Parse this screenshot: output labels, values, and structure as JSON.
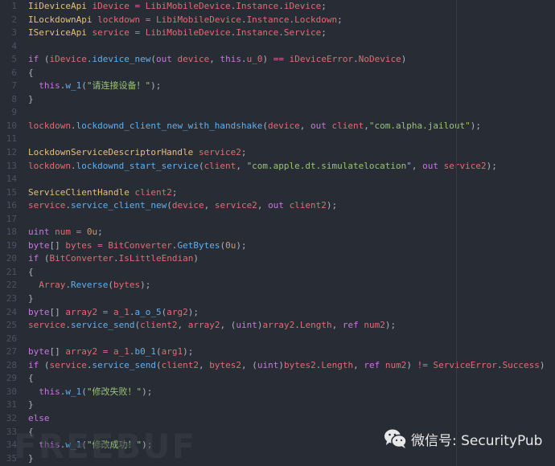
{
  "code": {
    "lines": [
      [
        [
          "t",
          "IiDeviceApi"
        ],
        [
          "p",
          " "
        ],
        [
          "v",
          "iDevice"
        ],
        [
          "o",
          " = "
        ],
        [
          "v",
          "LibiMobileDevice"
        ],
        [
          "p",
          "."
        ],
        [
          "v",
          "Instance"
        ],
        [
          "p",
          "."
        ],
        [
          "v",
          "iDevice"
        ],
        [
          "p",
          ";"
        ]
      ],
      [
        [
          "t",
          "ILockdownApi"
        ],
        [
          "p",
          " "
        ],
        [
          "v",
          "lockdown"
        ],
        [
          "o",
          " = "
        ],
        [
          "v",
          "LibiMobileDevice"
        ],
        [
          "p",
          "."
        ],
        [
          "v",
          "Instance"
        ],
        [
          "p",
          "."
        ],
        [
          "v",
          "Lockdown"
        ],
        [
          "p",
          ";"
        ]
      ],
      [
        [
          "t",
          "IServiceApi"
        ],
        [
          "p",
          " "
        ],
        [
          "v",
          "service"
        ],
        [
          "o",
          " = "
        ],
        [
          "v",
          "LibiMobileDevice"
        ],
        [
          "p",
          "."
        ],
        [
          "v",
          "Instance"
        ],
        [
          "p",
          "."
        ],
        [
          "v",
          "Service"
        ],
        [
          "p",
          ";"
        ]
      ],
      [],
      [
        [
          "k",
          "if"
        ],
        [
          "p",
          " ("
        ],
        [
          "v",
          "iDevice"
        ],
        [
          "p",
          "."
        ],
        [
          "f",
          "idevice_new"
        ],
        [
          "p",
          "("
        ],
        [
          "k",
          "out"
        ],
        [
          "p",
          " "
        ],
        [
          "v",
          "device"
        ],
        [
          "p",
          ", "
        ],
        [
          "k",
          "this"
        ],
        [
          "p",
          "."
        ],
        [
          "v",
          "u_0"
        ],
        [
          "p",
          ") "
        ],
        [
          "o",
          "=="
        ],
        [
          "p",
          " "
        ],
        [
          "v",
          "iDeviceError"
        ],
        [
          "p",
          "."
        ],
        [
          "v",
          "NoDevice"
        ],
        [
          "p",
          ")"
        ]
      ],
      [
        [
          "p",
          "{"
        ]
      ],
      [
        [
          "p",
          "  "
        ],
        [
          "k",
          "this"
        ],
        [
          "p",
          "."
        ],
        [
          "f",
          "w_1"
        ],
        [
          "p",
          "("
        ],
        [
          "s",
          "\"请连接设备！\""
        ],
        [
          "p",
          ");"
        ]
      ],
      [
        [
          "p",
          "}"
        ]
      ],
      [],
      [
        [
          "v",
          "lockdown"
        ],
        [
          "p",
          "."
        ],
        [
          "f",
          "lockdownd_client_new_with_handshake"
        ],
        [
          "p",
          "("
        ],
        [
          "v",
          "device"
        ],
        [
          "p",
          ", "
        ],
        [
          "k",
          "out"
        ],
        [
          "p",
          " "
        ],
        [
          "v",
          "client"
        ],
        [
          "p",
          ","
        ],
        [
          "s",
          "\"com.alpha.jailout\""
        ],
        [
          "p",
          ");"
        ]
      ],
      [],
      [
        [
          "t",
          "LockdownServiceDescriptorHandle"
        ],
        [
          "p",
          " "
        ],
        [
          "v",
          "service2"
        ],
        [
          "p",
          ";"
        ]
      ],
      [
        [
          "v",
          "lockdown"
        ],
        [
          "p",
          "."
        ],
        [
          "f",
          "lockdownd_start_service"
        ],
        [
          "p",
          "("
        ],
        [
          "v",
          "client"
        ],
        [
          "p",
          ", "
        ],
        [
          "s",
          "\"com.apple.dt.simulatelocation\""
        ],
        [
          "p",
          ", "
        ],
        [
          "k",
          "out"
        ],
        [
          "p",
          " "
        ],
        [
          "v",
          "service2"
        ],
        [
          "p",
          ");"
        ]
      ],
      [],
      [
        [
          "t",
          "ServiceClientHandle"
        ],
        [
          "p",
          " "
        ],
        [
          "v",
          "client2"
        ],
        [
          "p",
          ";"
        ]
      ],
      [
        [
          "v",
          "service"
        ],
        [
          "p",
          "."
        ],
        [
          "f",
          "service_client_new"
        ],
        [
          "p",
          "("
        ],
        [
          "v",
          "device"
        ],
        [
          "p",
          ", "
        ],
        [
          "v",
          "service2"
        ],
        [
          "p",
          ", "
        ],
        [
          "k",
          "out"
        ],
        [
          "p",
          " "
        ],
        [
          "v",
          "client2"
        ],
        [
          "p",
          ");"
        ]
      ],
      [],
      [
        [
          "k",
          "uint"
        ],
        [
          "p",
          " "
        ],
        [
          "v",
          "num"
        ],
        [
          "o",
          " = "
        ],
        [
          "n",
          "0u"
        ],
        [
          "p",
          ";"
        ]
      ],
      [
        [
          "k",
          "byte"
        ],
        [
          "p",
          "[] "
        ],
        [
          "v",
          "bytes"
        ],
        [
          "o",
          " = "
        ],
        [
          "v",
          "BitConverter"
        ],
        [
          "p",
          "."
        ],
        [
          "f",
          "GetBytes"
        ],
        [
          "p",
          "("
        ],
        [
          "n",
          "0u"
        ],
        [
          "p",
          ");"
        ]
      ],
      [
        [
          "k",
          "if"
        ],
        [
          "p",
          " ("
        ],
        [
          "v",
          "BitConverter"
        ],
        [
          "p",
          "."
        ],
        [
          "v",
          "IsLittleEndian"
        ],
        [
          "p",
          ")"
        ]
      ],
      [
        [
          "p",
          "{"
        ]
      ],
      [
        [
          "p",
          "  "
        ],
        [
          "v",
          "Array"
        ],
        [
          "p",
          "."
        ],
        [
          "f",
          "Reverse"
        ],
        [
          "p",
          "("
        ],
        [
          "v",
          "bytes"
        ],
        [
          "p",
          ");"
        ]
      ],
      [
        [
          "p",
          "}"
        ]
      ],
      [
        [
          "k",
          "byte"
        ],
        [
          "p",
          "[] "
        ],
        [
          "v",
          "array2"
        ],
        [
          "o",
          " = "
        ],
        [
          "v",
          "a_1"
        ],
        [
          "p",
          "."
        ],
        [
          "f",
          "a_o_5"
        ],
        [
          "p",
          "("
        ],
        [
          "v",
          "arg2"
        ],
        [
          "p",
          ");"
        ]
      ],
      [
        [
          "v",
          "service"
        ],
        [
          "p",
          "."
        ],
        [
          "f",
          "service_send"
        ],
        [
          "p",
          "("
        ],
        [
          "v",
          "client2"
        ],
        [
          "p",
          ", "
        ],
        [
          "v",
          "array2"
        ],
        [
          "p",
          ", ("
        ],
        [
          "k",
          "uint"
        ],
        [
          "p",
          ")"
        ],
        [
          "v",
          "array2"
        ],
        [
          "p",
          "."
        ],
        [
          "v",
          "Length"
        ],
        [
          "p",
          ", "
        ],
        [
          "k",
          "ref"
        ],
        [
          "p",
          " "
        ],
        [
          "v",
          "num2"
        ],
        [
          "p",
          ");"
        ]
      ],
      [],
      [
        [
          "k",
          "byte"
        ],
        [
          "p",
          "[] "
        ],
        [
          "v",
          "array2"
        ],
        [
          "o",
          " = "
        ],
        [
          "v",
          "a_1"
        ],
        [
          "p",
          "."
        ],
        [
          "f",
          "b0_1"
        ],
        [
          "p",
          "("
        ],
        [
          "v",
          "arg1"
        ],
        [
          "p",
          ");"
        ]
      ],
      [
        [
          "k",
          "if"
        ],
        [
          "p",
          " ("
        ],
        [
          "v",
          "service"
        ],
        [
          "p",
          "."
        ],
        [
          "f",
          "service_send"
        ],
        [
          "p",
          "("
        ],
        [
          "v",
          "client2"
        ],
        [
          "p",
          ", "
        ],
        [
          "v",
          "bytes2"
        ],
        [
          "p",
          ", ("
        ],
        [
          "k",
          "uint"
        ],
        [
          "p",
          ")"
        ],
        [
          "v",
          "bytes2"
        ],
        [
          "p",
          "."
        ],
        [
          "v",
          "Length"
        ],
        [
          "p",
          ", "
        ],
        [
          "k",
          "ref"
        ],
        [
          "p",
          " "
        ],
        [
          "v",
          "num2"
        ],
        [
          "p",
          ") "
        ],
        [
          "o",
          "!="
        ],
        [
          "p",
          " "
        ],
        [
          "v",
          "ServiceError"
        ],
        [
          "p",
          "."
        ],
        [
          "v",
          "Success"
        ],
        [
          "p",
          ")"
        ]
      ],
      [
        [
          "p",
          "{"
        ]
      ],
      [
        [
          "p",
          "  "
        ],
        [
          "k",
          "this"
        ],
        [
          "p",
          "."
        ],
        [
          "f",
          "w_1"
        ],
        [
          "p",
          "("
        ],
        [
          "s",
          "\"修改失败！\""
        ],
        [
          "p",
          ");"
        ]
      ],
      [
        [
          "p",
          "}"
        ]
      ],
      [
        [
          "k",
          "else"
        ]
      ],
      [
        [
          "p",
          "{"
        ]
      ],
      [
        [
          "p",
          "  "
        ],
        [
          "k",
          "this"
        ],
        [
          "p",
          "."
        ],
        [
          "f",
          "w_1"
        ],
        [
          "p",
          "("
        ],
        [
          "s",
          "\"修改成功！\""
        ],
        [
          "p",
          ");"
        ]
      ],
      [
        [
          "p",
          "}"
        ]
      ]
    ]
  },
  "watermark": {
    "freebuf": "FREEBUF",
    "wechat_label": "微信号: SecurityPub",
    "icon": "wechat-icon"
  },
  "colors": {
    "background": "#282c34",
    "keyword": "#c678dd",
    "variable": "#e06c75",
    "type": "#e5c07b",
    "function": "#61afef",
    "string": "#98c379",
    "number": "#d19a66"
  }
}
